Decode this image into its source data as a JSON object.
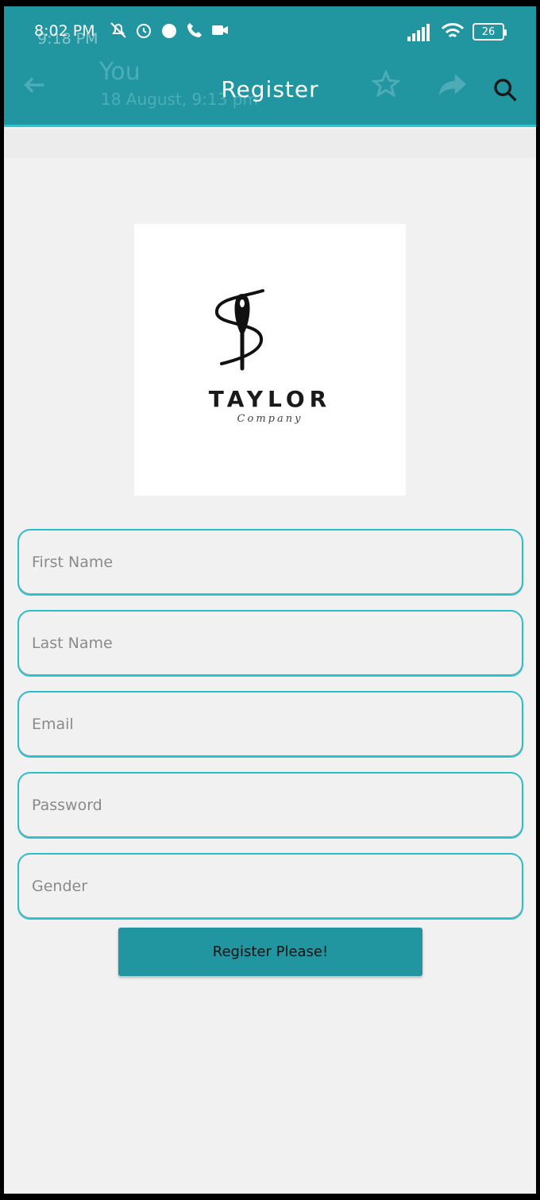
{
  "status_bar": {
    "time": "8:02 PM",
    "ghost_time": "9:18 PM",
    "battery": "26",
    "icons": [
      "mute-icon",
      "alarm-icon",
      "timer-icon",
      "call-icon",
      "video-icon"
    ],
    "right_icons": [
      "signal-icon",
      "wifi-icon",
      "battery-icon"
    ]
  },
  "ghost_overlay": {
    "sender": "You",
    "date": "18 August, 9:13 pm"
  },
  "appbar": {
    "title": "Register",
    "search_icon": "search-icon"
  },
  "logo": {
    "name": "TAYLOR",
    "subtitle": "Company"
  },
  "form": {
    "first_name_placeholder": "First Name",
    "last_name_placeholder": "Last Name",
    "email_placeholder": "Email",
    "password_placeholder": "Password",
    "gender_placeholder": "Gender",
    "submit_label": "Register Please!"
  },
  "colors": {
    "primary": "#2196a0",
    "accent": "#27c9d6",
    "background": "#f1f1f1"
  }
}
